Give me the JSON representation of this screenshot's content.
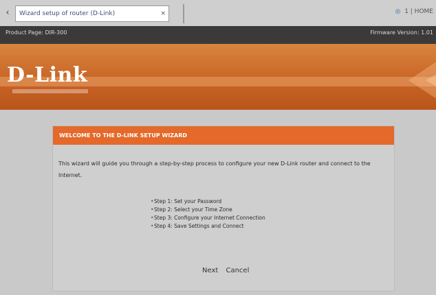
{
  "browser": {
    "tab_title": "Wizard setup of router (D-Link)",
    "tab_close": "×",
    "right_tools": "1  |  HOME"
  },
  "product_bar": {
    "left": "Product Page: DIR-300",
    "right": "Firmware Version: 1.01"
  },
  "brand": {
    "logo": "D-Link",
    "colors": {
      "orange": "#e4692a",
      "dark": "#3b3a39"
    }
  },
  "wizard": {
    "header": "WELCOME TO THE D-LINK SETUP WIZARD",
    "intro": "This wizard will guide you through a step-by-step process to configure your new D-Link router and connect to the Internet.",
    "steps": [
      "Step 1: Set your Password",
      "Step 2: Select your Time Zone",
      "Step 3: Configure your Internet Connection",
      "Step 4: Save Settings and Connect"
    ],
    "next_label": "Next",
    "cancel_label": "Cancel"
  }
}
